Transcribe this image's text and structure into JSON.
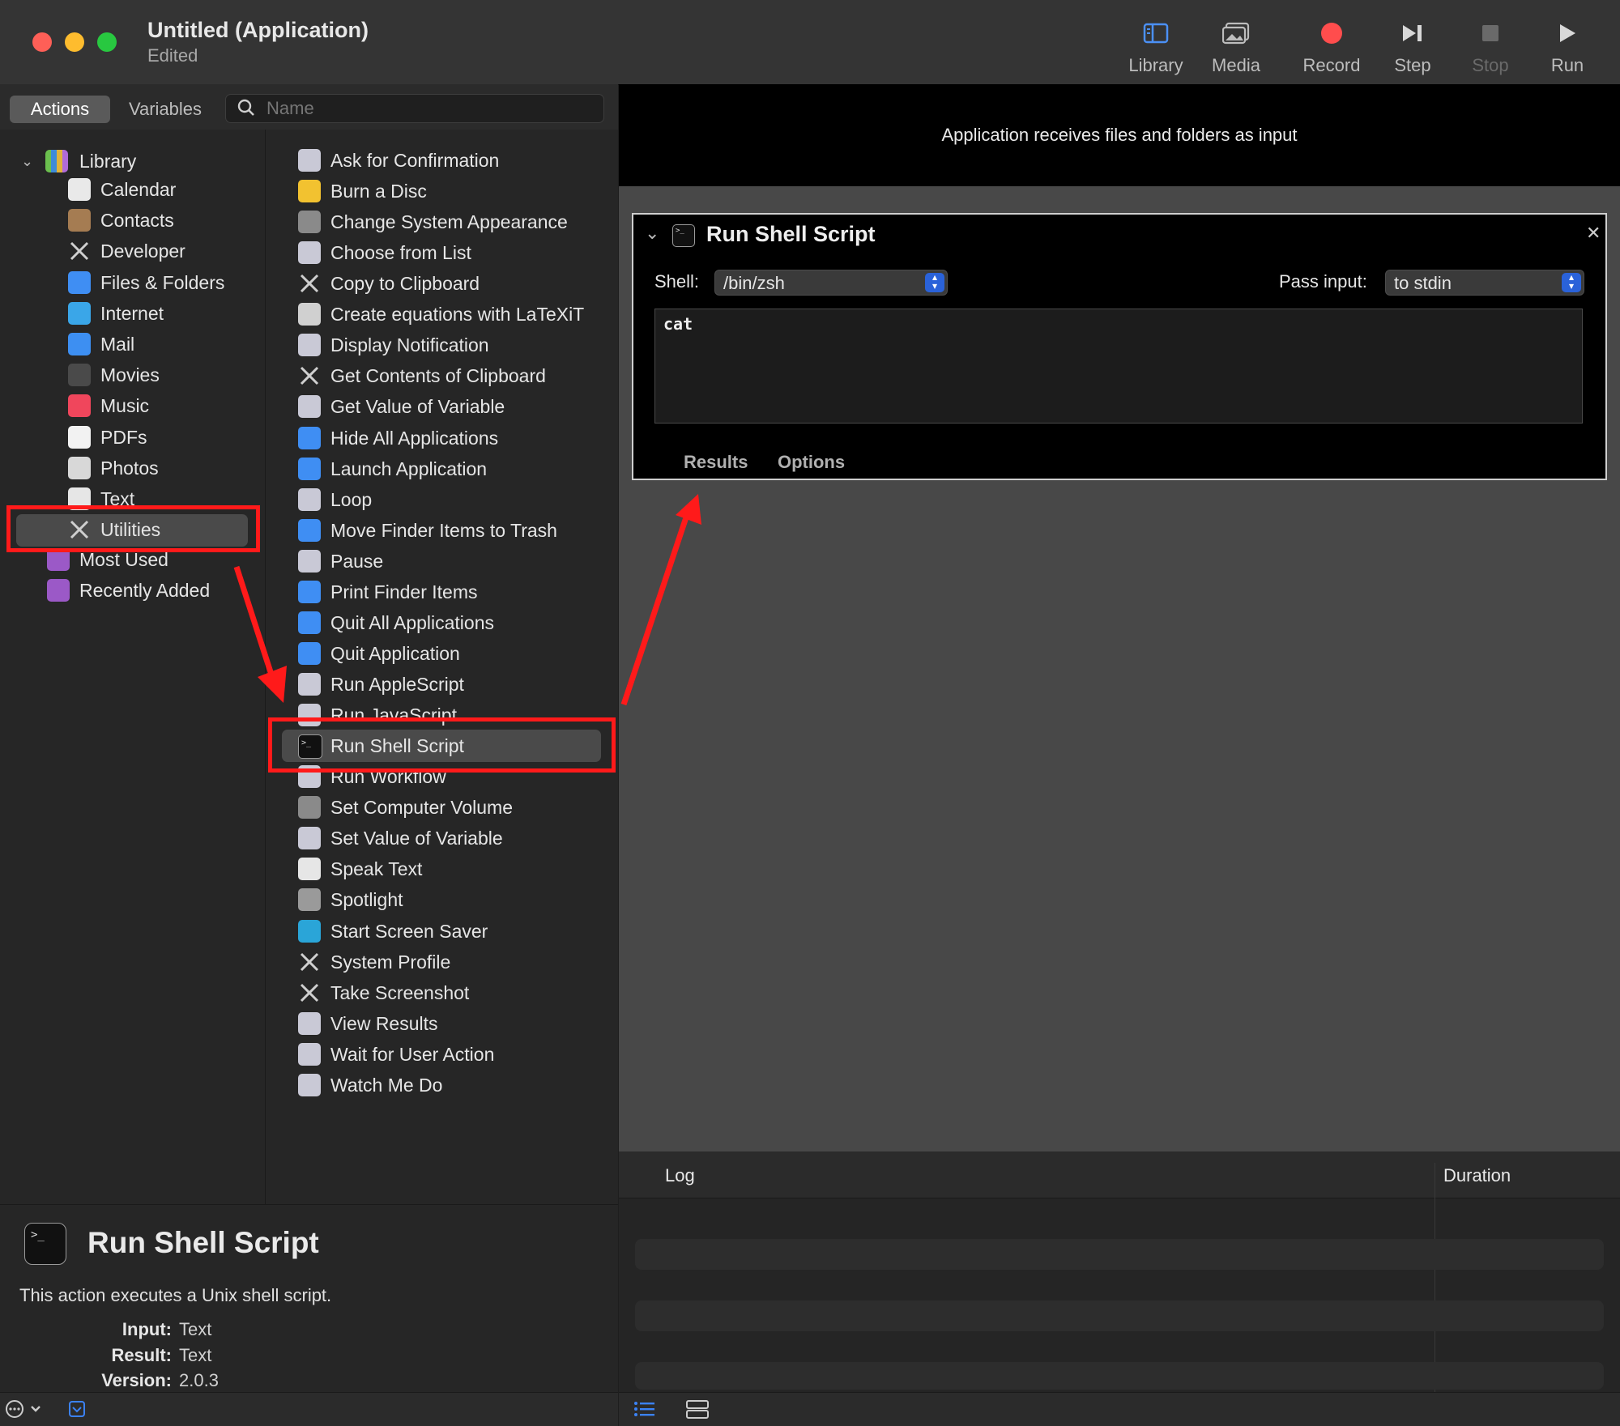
{
  "window": {
    "title": "Untitled (Application)",
    "subtitle": "Edited"
  },
  "toolbar": {
    "buttons": [
      {
        "label": "Library",
        "icon": "library-icon",
        "color": "#4b90f5"
      },
      {
        "label": "Media",
        "icon": "media-icon",
        "color": "#bdbdbd"
      },
      {
        "label": "Record",
        "icon": "record-icon",
        "color": "#ff4d4d"
      },
      {
        "label": "Step",
        "icon": "step-icon",
        "color": "#d8d8d8"
      },
      {
        "label": "Stop",
        "icon": "stop-icon",
        "color": "#6a6a6a"
      },
      {
        "label": "Run",
        "icon": "run-icon",
        "color": "#d8d8d8"
      }
    ]
  },
  "tabs": {
    "actions": "Actions",
    "variables": "Variables"
  },
  "search": {
    "placeholder": "Name"
  },
  "library": {
    "root": "Library",
    "items": [
      "Calendar",
      "Contacts",
      "Developer",
      "Files & Folders",
      "Internet",
      "Mail",
      "Movies",
      "Music",
      "PDFs",
      "Photos",
      "Text",
      "Utilities"
    ],
    "selected": "Utilities",
    "extras": [
      "Most Used",
      "Recently Added"
    ]
  },
  "actions": {
    "items": [
      "Ask for Confirmation",
      "Burn a Disc",
      "Change System Appearance",
      "Choose from List",
      "Copy to Clipboard",
      "Create equations with LaTeXiT",
      "Display Notification",
      "Get Contents of Clipboard",
      "Get Value of Variable",
      "Hide All Applications",
      "Launch Application",
      "Loop",
      "Move Finder Items to Trash",
      "Pause",
      "Print Finder Items",
      "Quit All Applications",
      "Quit Application",
      "Run AppleScript",
      "Run JavaScript",
      "Run Shell Script",
      "Run Workflow",
      "Set Computer Volume",
      "Set Value of Variable",
      "Speak Text",
      "Spotlight",
      "Start Screen Saver",
      "System Profile",
      "Take Screenshot",
      "View Results",
      "Wait for User Action",
      "Watch Me Do"
    ],
    "selected": "Run Shell Script"
  },
  "description": {
    "title": "Run Shell Script",
    "text": "This action executes a Unix shell script.",
    "input_label": "Input:",
    "input": "Text",
    "result_label": "Result:",
    "result": "Text",
    "version_label": "Version:",
    "version": "2.0.3"
  },
  "workflow": {
    "input_banner": "Application receives files and folders as input",
    "card": {
      "title": "Run Shell Script",
      "shell_label": "Shell:",
      "shell": "/bin/zsh",
      "pass_label": "Pass input:",
      "pass": "to stdin",
      "script": "cat",
      "tab_results": "Results",
      "tab_options": "Options"
    }
  },
  "log": {
    "col_log": "Log",
    "col_duration": "Duration"
  },
  "colors": {
    "highlight": "#ff1a1a",
    "selection": "#4a4a4a",
    "accent": "#2a62d9"
  }
}
